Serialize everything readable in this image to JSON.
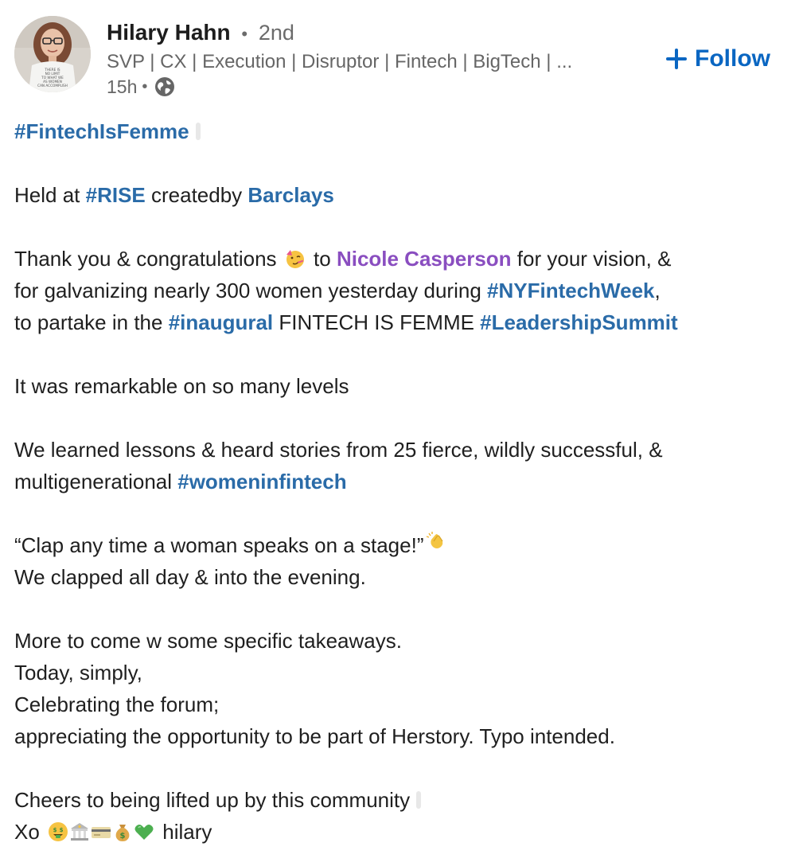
{
  "author": {
    "name": "Hilary Hahn",
    "separator": "•",
    "degree": "2nd",
    "headline": "SVP | CX | Execution | Disruptor | Fintech | BigTech | ...",
    "time": "15h",
    "time_separator": "•",
    "visibility_icon": "globe-icon",
    "avatar_shirt_text": [
      "THERE IS",
      "NO LIMIT",
      "TO WHAT WE",
      "AS WOMEN",
      "CAN ACCOMPLISH"
    ]
  },
  "follow": {
    "icon": "plus-icon",
    "label": "Follow",
    "color": "#0a66c2"
  },
  "colors": {
    "hashtag": "#2a6ba8",
    "person_mention": "#8a4ec0",
    "body_text": "#1f1f1f",
    "meta_text": "#666666"
  },
  "post": {
    "l1": {
      "tag": "#FintechIsFemme"
    },
    "l2": {
      "a": "Held at ",
      "tag": "#RISE",
      "b": " createdby ",
      "mention": "Barclays"
    },
    "l3": {
      "a": "Thank you & congratulations",
      "b": "to ",
      "person": "Nicole Casperson",
      "c": " for your vision, &"
    },
    "l4": {
      "a": "for galvanizing nearly 300 women yesterday during ",
      "tag": "#NYFintechWeek",
      "b": ","
    },
    "l5": {
      "a": "to partake in the ",
      "tag1": "#inaugural",
      "b": " FINTECH IS FEMME ",
      "tag2": "#LeadershipSummit"
    },
    "l6": "It was remarkable on so many levels",
    "l7": "We learned lessons & heard stories from 25 fierce, wildly successful, &",
    "l8": {
      "a": "multigenerational ",
      "tag": "#womeninfintech"
    },
    "l9": "“Clap any time a woman speaks on a stage!”",
    "l10": "We clapped all day & into the evening.",
    "l11": "More to come w some specific takeaways.",
    "l12": "Today, simply,",
    "l13": "Celebrating the forum;",
    "l14": "appreciating the opportunity to be part of Herstory. Typo intended.",
    "l15": "Cheers to being lifted up by this community",
    "l16": {
      "a": "Xo",
      "b": "hilary"
    },
    "emoji_names": [
      "partying-face-emoji",
      "clapping-hands-emoji",
      "money-mouth-face-emoji",
      "bank-emoji",
      "credit-card-emoji",
      "money-bag-emoji",
      "green-heart-emoji"
    ]
  }
}
